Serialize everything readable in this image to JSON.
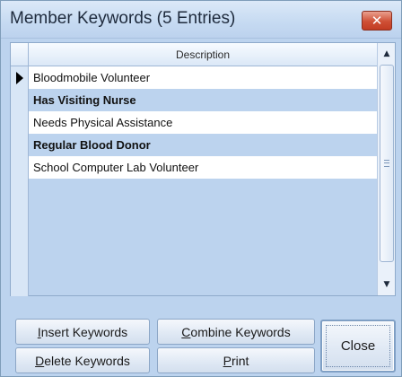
{
  "window": {
    "title": "Member Keywords (5 Entries)",
    "close_glyph": "✕"
  },
  "grid": {
    "column_header": "Description",
    "rows": [
      {
        "description": "Bloodmobile Volunteer",
        "current": true
      },
      {
        "description": "Has Visiting Nurse",
        "current": false
      },
      {
        "description": "Needs Physical Assistance",
        "current": false
      },
      {
        "description": "Regular Blood Donor",
        "current": false
      },
      {
        "description": "School Computer Lab Volunteer",
        "current": false
      }
    ]
  },
  "scrollbar": {
    "up_glyph": "▲",
    "down_glyph": "▼"
  },
  "buttons": {
    "insert": {
      "mnemonic": "I",
      "rest": "nsert Keywords"
    },
    "combine": {
      "mnemonic": "C",
      "rest": "ombine Keywords"
    },
    "delete": {
      "mnemonic": "D",
      "rest": "elete Keywords"
    },
    "print": {
      "mnemonic": "P",
      "rest": "rint"
    },
    "close": "Close"
  },
  "colors": {
    "window_bg": "#bcd3ee",
    "title_close_red": "#cf4f35",
    "row_alt": "#bcd3ee",
    "row_normal": "#ffffff"
  },
  "icons": {
    "close": "close-icon",
    "row_pointer": "row-pointer-icon",
    "scroll_up": "scroll-up-arrow-icon",
    "scroll_down": "scroll-down-arrow-icon"
  }
}
